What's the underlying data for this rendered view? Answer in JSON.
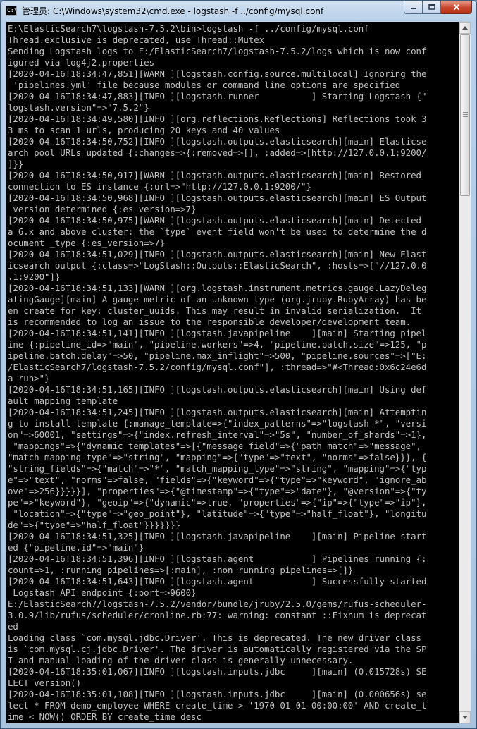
{
  "window": {
    "title": "管理员: C:\\Windows\\system32\\cmd.exe - logstash  -f ../config/mysql.conf",
    "icon_text": "C:\\"
  },
  "icons": {
    "app": "cmd-icon",
    "minimize": "minimize-icon",
    "maximize": "maximize-icon",
    "close": "close-icon",
    "scroll_up": "arrow-up-icon",
    "scroll_down": "arrow-down-icon"
  },
  "colors": {
    "console_bg": "#000000",
    "console_fg": "#c0c0c0",
    "close_button": "#c7452c"
  },
  "console": {
    "lines": [
      "E:\\ElasticSearch7\\logstash-7.5.2\\bin>logstash -f ../config/mysql.conf",
      "Thread.exclusive is deprecated, use Thread::Mutex",
      "Sending Logstash logs to E:/ElasticSearch7/logstash-7.5.2/logs which is now conf",
      "igured via log4j2.properties",
      "[2020-04-16T18:34:47,851][WARN ][logstash.config.source.multilocal] Ignoring the",
      " 'pipelines.yml' file because modules or command line options are specified",
      "[2020-04-16T18:34:47,883][INFO ][logstash.runner          ] Starting Logstash {\"",
      "logstash.version\"=>\"7.5.2\"}",
      "[2020-04-16T18:34:49,580][INFO ][org.reflections.Reflections] Reflections took 3",
      "3 ms to scan 1 urls, producing 20 keys and 40 values",
      "[2020-04-16T18:34:50,752][INFO ][logstash.outputs.elasticsearch][main] Elasticse",
      "arch pool URLs updated {:changes=>{:removed=>[], :added=>[http://127.0.0.1:9200/",
      "]}}",
      "[2020-04-16T18:34:50,917][WARN ][logstash.outputs.elasticsearch][main] Restored",
      "connection to ES instance {:url=>\"http://127.0.0.1:9200/\"}",
      "[2020-04-16T18:34:50,968][INFO ][logstash.outputs.elasticsearch][main] ES Output",
      " version determined {:es_version=>7}",
      "[2020-04-16T18:34:50,975][WARN ][logstash.outputs.elasticsearch][main] Detected",
      "a 6.x and above cluster: the `type` event field won't be used to determine the d",
      "ocument _type {:es_version=>7}",
      "[2020-04-16T18:34:51,029][INFO ][logstash.outputs.elasticsearch][main] New Elast",
      "icsearch output {:class=>\"LogStash::Outputs::ElasticSearch\", :hosts=>[\"//127.0.0",
      ".1:9200\"]}",
      "[2020-04-16T18:34:51,133][WARN ][org.logstash.instrument.metrics.gauge.LazyDeleg",
      "atingGauge][main] A gauge metric of an unknown type (org.jruby.RubyArray) has be",
      "en create for key: cluster_uuids. This may result in invalid serialization.  It",
      "is recommended to log an issue to the responsible developer/development team.",
      "[2020-04-16T18:34:51,141][INFO ][logstash.javapipeline    ][main] Starting pipel",
      "ine {:pipeline_id=>\"main\", \"pipeline.workers\"=>4, \"pipeline.batch.size\"=>125, \"p",
      "ipeline.batch.delay\"=>50, \"pipeline.max_inflight\"=>500, \"pipeline.sources\"=>[\"E:",
      "/ElasticSearch7/logstash-7.5.2/config/mysql.conf\"], :thread=>\"#<Thread:0x6c24e6d",
      "a run>\"}",
      "[2020-04-16T18:34:51,165][INFO ][logstash.outputs.elasticsearch][main] Using def",
      "ault mapping template",
      "[2020-04-16T18:34:51,245][INFO ][logstash.outputs.elasticsearch][main] Attemptin",
      "g to install template {:manage_template=>{\"index_patterns\"=>\"logstash-*\", \"versi",
      "on\"=>60001, \"settings\"=>{\"index.refresh_interval\"=>\"5s\", \"number_of_shards\"=>1},",
      " \"mappings\"=>{\"dynamic_templates\"=>[{\"message_field\"=>{\"path_match\"=>\"message\",",
      "\"match_mapping_type\"=>\"string\", \"mapping\"=>{\"type\"=>\"text\", \"norms\"=>false}}}, {",
      "\"string_fields\"=>{\"match\"=>\"*\", \"match_mapping_type\"=>\"string\", \"mapping\"=>{\"typ",
      "e\"=>\"text\", \"norms\"=>false, \"fields\"=>{\"keyword\"=>{\"type\"=>\"keyword\", \"ignore_ab",
      "ove\"=>256}}}}}], \"properties\"=>{\"@timestamp\"=>{\"type\"=>\"date\"}, \"@version\"=>{\"ty",
      "pe\"=>\"keyword\"}, \"geoip\"=>{\"dynamic\"=>true, \"properties\"=>{\"ip\"=>{\"type\"=>\"ip\"},",
      " \"location\"=>{\"type\"=>\"geo_point\"}, \"latitude\"=>{\"type\"=>\"half_float\"}, \"longitu",
      "de\"=>{\"type\"=>\"half_float\"}}}}}}}",
      "[2020-04-16T18:34:51,325][INFO ][logstash.javapipeline    ][main] Pipeline start",
      "ed {\"pipeline.id\"=>\"main\"}",
      "[2020-04-16T18:34:51,396][INFO ][logstash.agent           ] Pipelines running {:",
      "count=>1, :running_pipelines=>[:main], :non_running_pipelines=>[]}",
      "[2020-04-16T18:34:51,643][INFO ][logstash.agent           ] Successfully started",
      " Logstash API endpoint {:port=>9600}",
      "E:/ElasticSearch7/logstash-7.5.2/vendor/bundle/jruby/2.5.0/gems/rufus-scheduler-",
      "3.0.9/lib/rufus/scheduler/cronline.rb:77: warning: constant ::Fixnum is deprecat",
      "ed",
      "Loading class `com.mysql.jdbc.Driver'. This is deprecated. The new driver class",
      "is `com.mysql.cj.jdbc.Driver'. The driver is automatically registered via the SP",
      "I and manual loading of the driver class is generally unnecessary.",
      "[2020-04-16T18:35:01,067][INFO ][logstash.inputs.jdbc     ][main] (0.015728s) SE",
      "LECT version()",
      "[2020-04-16T18:35:01,108][INFO ][logstash.inputs.jdbc     ][main] (0.000656s) se",
      "lect * FROM demo_employee WHERE create_time > '1970-01-01 00:00:00' AND create_t",
      "ime < NOW() ORDER BY create_time desc"
    ]
  }
}
